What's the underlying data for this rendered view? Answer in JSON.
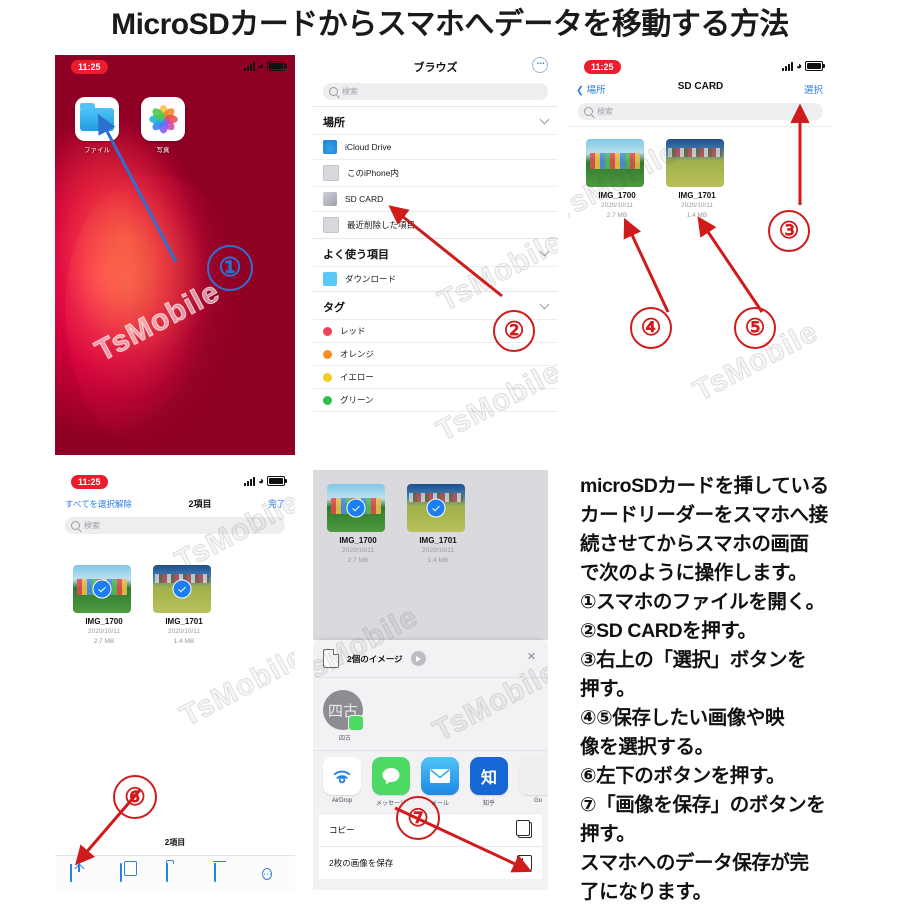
{
  "title": "MicroSDカードからスマホへデータを移動する方法",
  "watermark": "TsMobile",
  "panel_home": {
    "status": {
      "time": "11:25"
    },
    "apps": [
      {
        "label": "ファイル",
        "icon": "files-icon"
      },
      {
        "label": "写真",
        "icon": "photos-icon"
      }
    ],
    "step": "①"
  },
  "panel_browse": {
    "nav_title": "ブラウズ",
    "more_icon": "ellipsis-icon",
    "search_placeholder": "検索",
    "sections": [
      {
        "header": "場所",
        "items": [
          {
            "label": "iCloud Drive",
            "icon": "icloud-icon"
          },
          {
            "label": "このiPhone内",
            "icon": "iphone-icon"
          },
          {
            "label": "SD CARD",
            "icon": "sdcard-icon"
          },
          {
            "label": "最近削除した項目",
            "icon": "trash-icon"
          }
        ]
      },
      {
        "header": "よく使う項目",
        "items": [
          {
            "label": "ダウンロード",
            "icon": "folder-icon"
          }
        ]
      },
      {
        "header": "タグ",
        "items": [
          {
            "label": "レッド",
            "color": "#ef4056"
          },
          {
            "label": "オレンジ",
            "color": "#f59026"
          },
          {
            "label": "イエロー",
            "color": "#f5ca22"
          },
          {
            "label": "グリーン",
            "color": "#2fc04a"
          }
        ]
      }
    ],
    "step": "②"
  },
  "panel_sdcard": {
    "status": {
      "time": "11:25"
    },
    "back_label": "場所",
    "nav_title": "SD CARD",
    "select_label": "選択",
    "search_placeholder": "検索",
    "files": [
      {
        "name": "IMG_1700",
        "date": "2020/10/11",
        "size": "2.7 MB"
      },
      {
        "name": "IMG_1701",
        "date": "2020/10/11",
        "size": "1.4 MB"
      }
    ],
    "steps": {
      "three": "③",
      "four": "④",
      "five": "⑤"
    }
  },
  "panel_selected": {
    "status": {
      "time": "11:25"
    },
    "deselect_label": "すべてを選択解除",
    "count_label": "2項目",
    "done_label": "完了",
    "search_placeholder": "検索",
    "files": [
      {
        "name": "IMG_1700",
        "date": "2020/10/11",
        "size": "2.7 MB"
      },
      {
        "name": "IMG_1701",
        "date": "2020/10/11",
        "size": "1.4 MB"
      }
    ],
    "footer_count": "2項目",
    "toolbar": [
      {
        "icon": "share-icon"
      },
      {
        "icon": "duplicate-icon"
      },
      {
        "icon": "new-folder-icon"
      },
      {
        "icon": "trash-icon"
      },
      {
        "icon": "more-icon"
      }
    ],
    "step": "⑥"
  },
  "panel_share": {
    "files": [
      {
        "name": "IMG_1700",
        "date": "2020/10/11",
        "size": "2.7 MB"
      },
      {
        "name": "IMG_1701",
        "date": "2020/10/11",
        "size": "1.4 MB"
      }
    ],
    "sheet_title": "2個のイメージ",
    "close_icon": "close-icon",
    "contacts": [
      {
        "initials": "四古",
        "label": "四古"
      }
    ],
    "apps": [
      {
        "label": "AirDrop",
        "icon": "airdrop-icon",
        "color": "#ffffff"
      },
      {
        "label": "メッセージ",
        "icon": "messages-icon",
        "color": "#4cd964"
      },
      {
        "label": "メール",
        "icon": "mail-icon",
        "color": "#2f9ce8"
      },
      {
        "label": "知乎",
        "icon": "zhihu-icon",
        "color": "#1766d6"
      },
      {
        "label": "Go",
        "icon": "app-icon",
        "color": "#efeff2"
      }
    ],
    "actions": [
      {
        "label": "コピー",
        "icon": "copy-icon"
      },
      {
        "label": "2枚の画像を保存",
        "icon": "save-image-icon"
      }
    ],
    "step": "⑦"
  },
  "instructions": {
    "lines": [
      "microSDカードを挿している",
      "カードリーダーをスマホへ接",
      "続させてからスマホの画面",
      "で次のように操作します。",
      "①スマホのファイルを開く。",
      "②SD CARDを押す。",
      "③右上の「選択」ボタンを",
      "押す。",
      "④⑤保存したい画像や映",
      "像を選択する。",
      "⑥左下のボタンを押す。",
      "⑦「画像を保存」のボタンを",
      "押す。",
      "スマホへのデータ保存が完",
      "了になります。"
    ]
  },
  "colors": {
    "accent_blue": "#2f7fe0",
    "annotation_red": "#cf1b1b",
    "annotation_blue": "#2f6fd0",
    "time_pill_red": "#ec1c2e"
  }
}
